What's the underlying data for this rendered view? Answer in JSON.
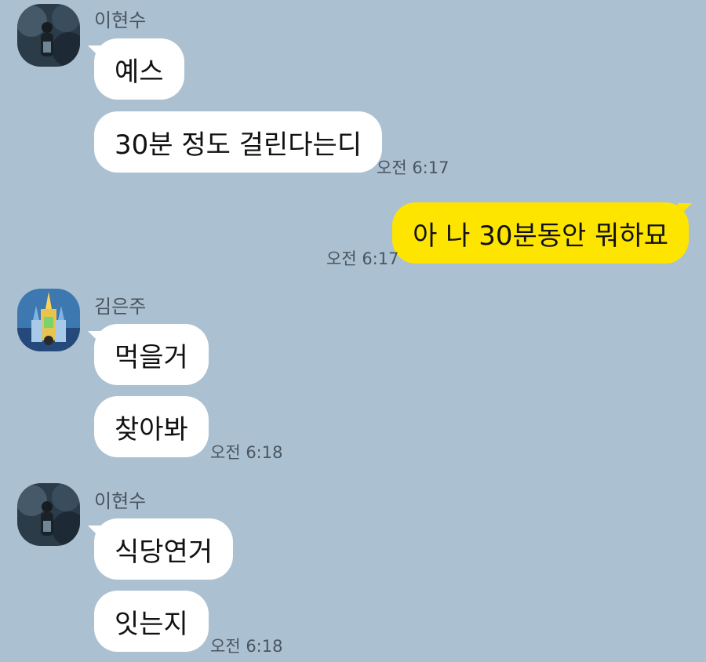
{
  "chat": {
    "groups": [
      {
        "sender": "이현수",
        "avatar": "profile-photo-dark-forest",
        "messages": [
          "예스",
          "30분 정도 걸린다는디"
        ],
        "time": "오전 6:17"
      },
      {
        "sender": "me",
        "messages": [
          "아 나 30분동안 뭐하묘"
        ],
        "time": "오전 6:17"
      },
      {
        "sender": "김은주",
        "avatar": "profile-photo-castle-night",
        "messages": [
          "먹을거",
          "찾아봐"
        ],
        "time": "오전 6:18"
      },
      {
        "sender": "이현수",
        "avatar": "profile-photo-dark-forest",
        "messages": [
          "식당연거",
          "잇는지"
        ],
        "time": "오전 6:18"
      }
    ]
  },
  "colors": {
    "background": "#abc1d1",
    "incoming_bubble": "#ffffff",
    "outgoing_bubble": "#fee500",
    "meta_text": "#4a5560"
  }
}
